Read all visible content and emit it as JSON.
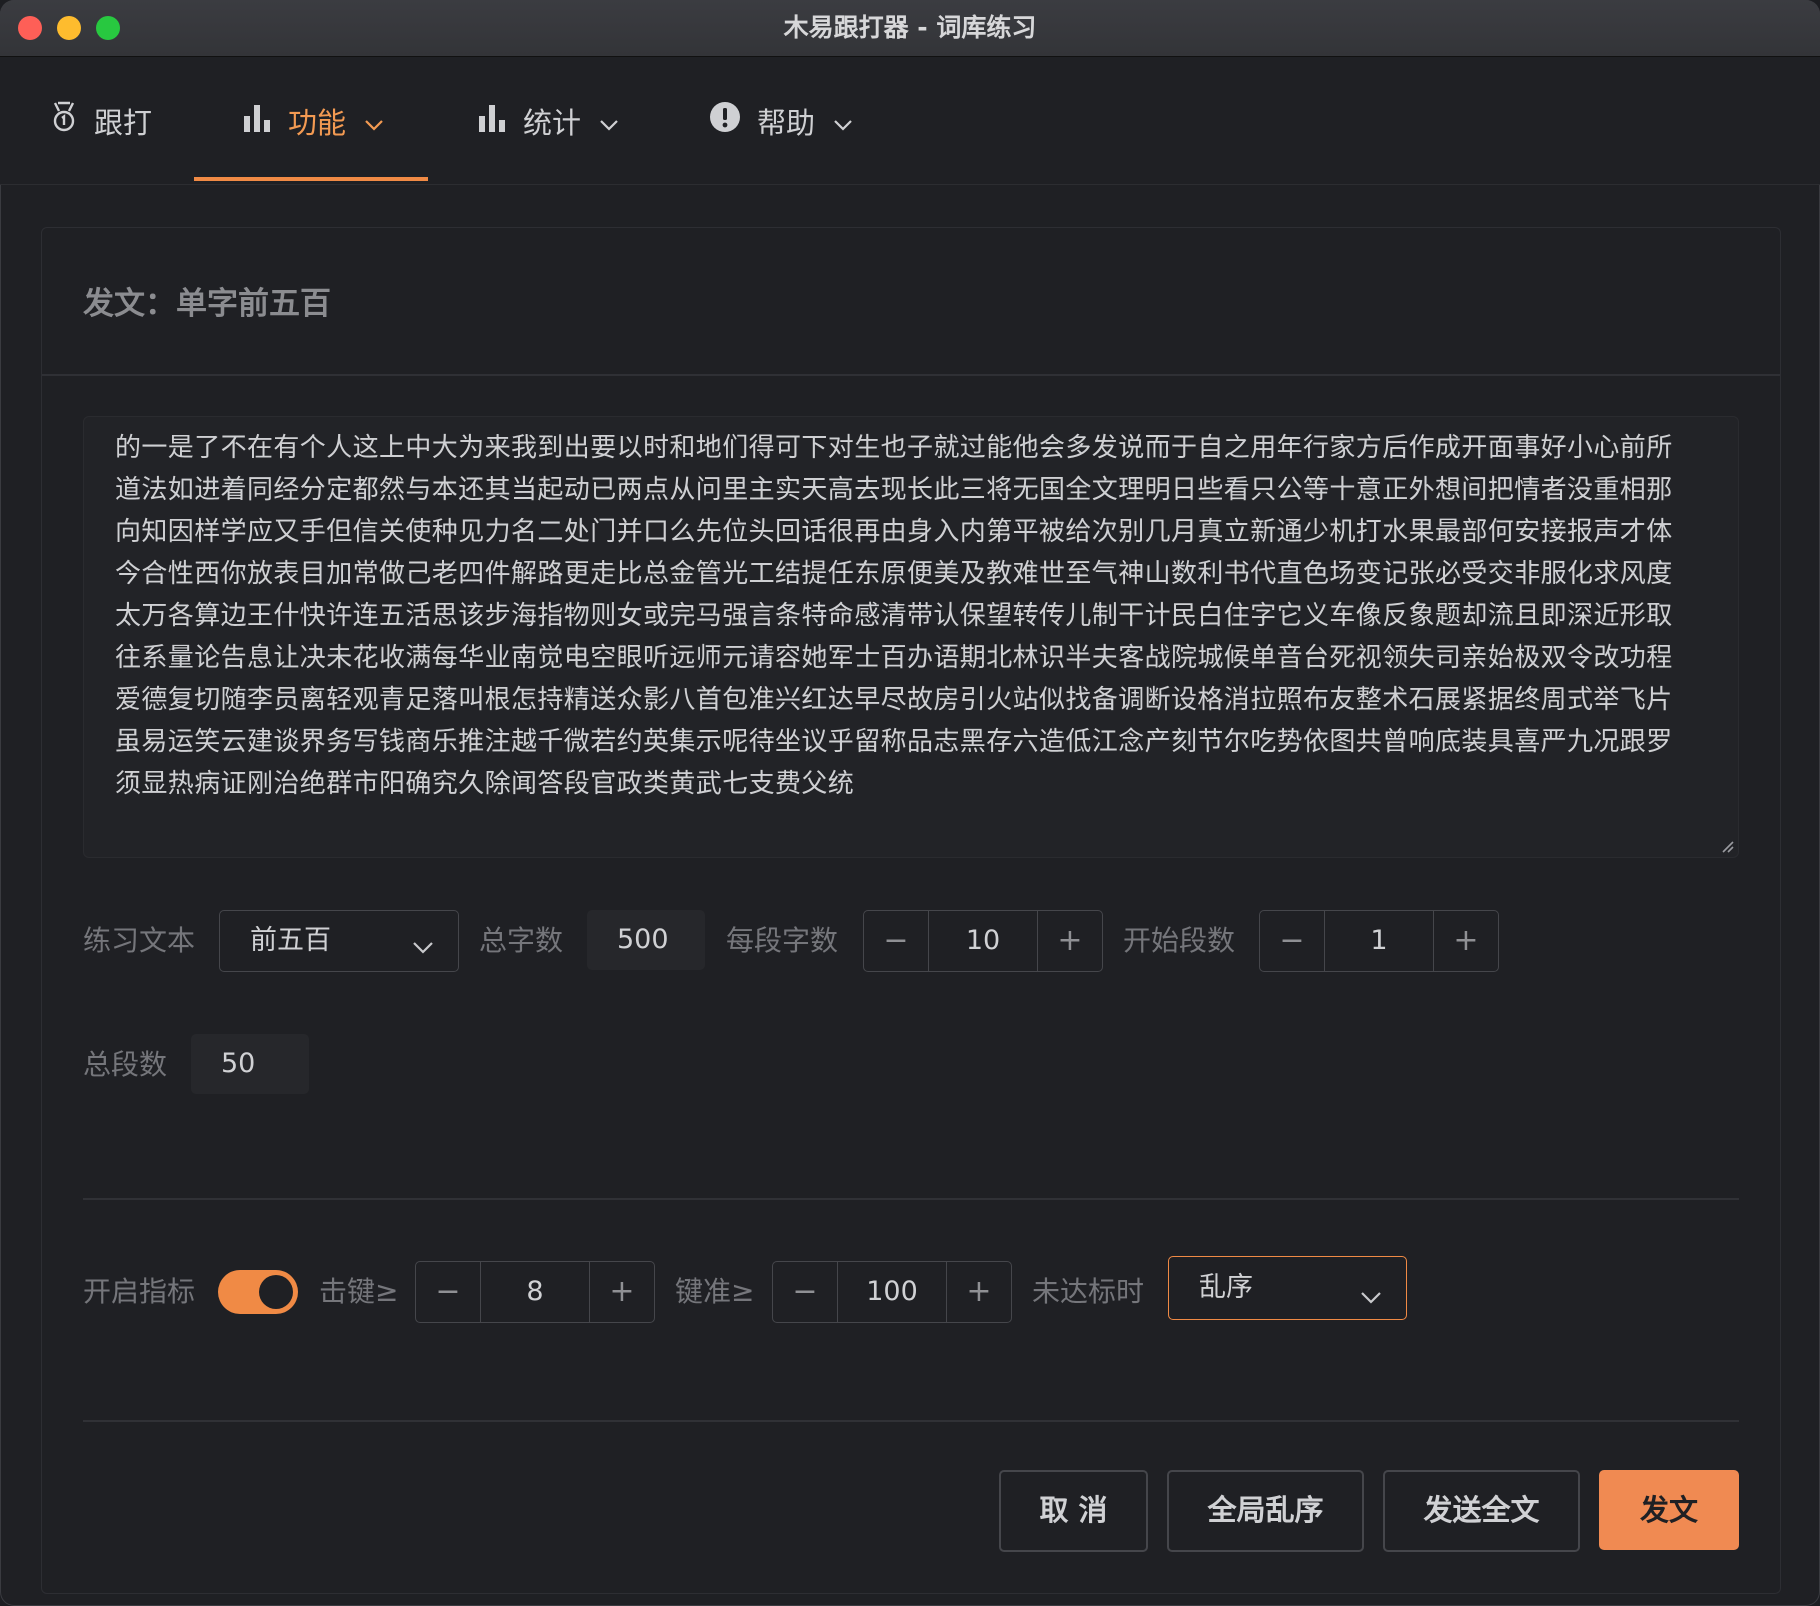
{
  "window": {
    "title": "木易跟打器 - 词库练习"
  },
  "menu": {
    "items": [
      {
        "label": "跟打",
        "icon": "medal-icon"
      },
      {
        "label": "功能",
        "icon": "bar-chart-icon",
        "active": true
      },
      {
        "label": "统计",
        "icon": "bar-chart-icon"
      },
      {
        "label": "帮助",
        "icon": "alert-circle-icon"
      }
    ]
  },
  "card": {
    "title": "发文：单字前五百",
    "text": "的一是了不在有个人这上中大为来我到出要以时和地们得可下对生也子就过能他会多发说而于自之用年行家方后作成开面事好小心前所道法如进着同经分定都然与本还其当起动已两点从问里主实天高去现长此三将无国全文理明日些看只公等十意正外想间把情者没重相那向知因样学应又手但信关使种见力名二处门并口么先位头回话很再由身入内第平被给次别几月真立新通少机打水果最部何安接报声才体今合性西你放表目加常做己老四件解路更走比总金管光工结提任东原便美及教难世至气神山数利书代直色场变记张必受交非服化求风度太万各算边王什快许连五活思该步海指物则女或完马强言条特命感清带认保望转传儿制干计民白住字它义车像反象题却流且即深近形取往系量论告息让决未花收满每华业南觉电空眼听远师元请容她军士百办语期北林识半夫客战院城候单音台死视领失司亲始极双令改功程爱德复切随李员离轻观青足落叫根怎持精送众影八首包准兴红达早尽故房引火站似找备调断设格消拉照布友整术石展紧据终周式举飞片虽易运笑云建谈界务写钱商乐推注越千微若约英集示呢待坐议乎留称品志黑存六造低江念产刻节尔吃势依图共曾响底装具喜严九况跟罗须显热病证刚治绝群市阳确究久除闻答段官政类黄武七支费父统"
  },
  "settings": {
    "practice_text_label": "练习文本",
    "practice_text_value": "前五百",
    "total_chars_label": "总字数",
    "total_chars_value": "500",
    "chars_per_seg_label": "每段字数",
    "chars_per_seg_value": "10",
    "start_seg_label": "开始段数",
    "start_seg_value": "1",
    "total_segs_label": "总段数",
    "total_segs_value": "50"
  },
  "indicators": {
    "enable_label": "开启指标",
    "enabled": true,
    "keystroke_label": "击键≥",
    "keystroke_value": "8",
    "accuracy_label": "键准≥",
    "accuracy_value": "100",
    "fail_label": "未达标时",
    "fail_action": "乱序"
  },
  "stepper": {
    "minus": "−",
    "plus": "+"
  },
  "buttons": {
    "cancel": "取 消",
    "shuffle_all": "全局乱序",
    "send_full": "发送全文",
    "send": "发文"
  },
  "colors": {
    "accent": "#f08a45",
    "background": "#1f2024"
  }
}
